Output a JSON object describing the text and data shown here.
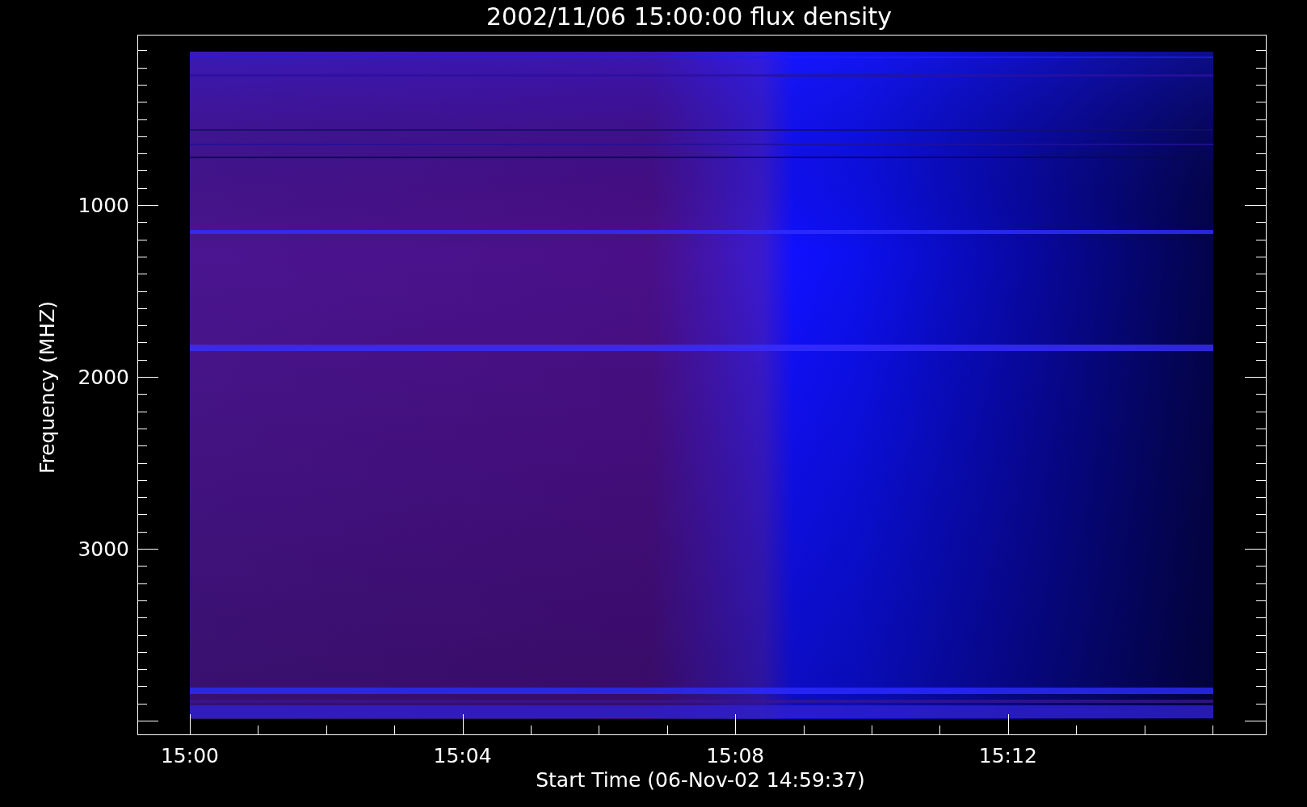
{
  "plot": {
    "title": "2002/11/06 15:00:00 flux density",
    "x_axis": {
      "label": "Start Time (06-Nov-02 14:59:37)",
      "ticks": [
        "15:00",
        "15:04",
        "15:08",
        "15:12"
      ]
    },
    "y_axis": {
      "label": "Frequency (MHZ)",
      "ticks": [
        "1000",
        "2000",
        "3000"
      ]
    }
  }
}
